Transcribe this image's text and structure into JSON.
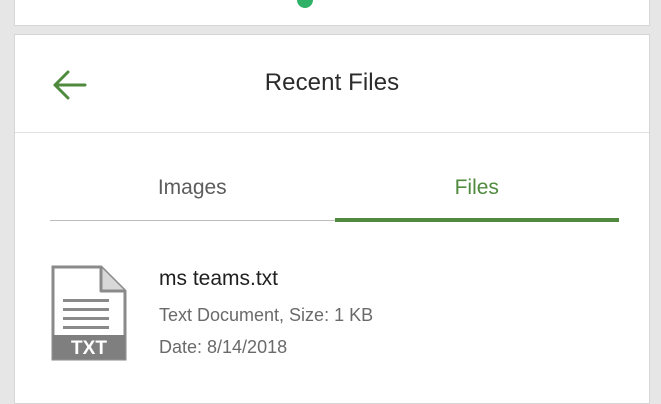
{
  "header": {
    "title": "Recent Files",
    "back_icon": "arrow-left-icon"
  },
  "tabs": [
    {
      "label": "Images",
      "active": false
    },
    {
      "label": "Files",
      "active": true
    }
  ],
  "files": [
    {
      "name": "ms teams.txt",
      "type_and_size": "Text Document, Size: 1 KB",
      "date": "Date: 8/14/2018",
      "icon": "txt-file-icon",
      "icon_label": "TXT"
    }
  ],
  "colors": {
    "accent": "#4f8a3f",
    "top_indicator": "#2fb267"
  }
}
